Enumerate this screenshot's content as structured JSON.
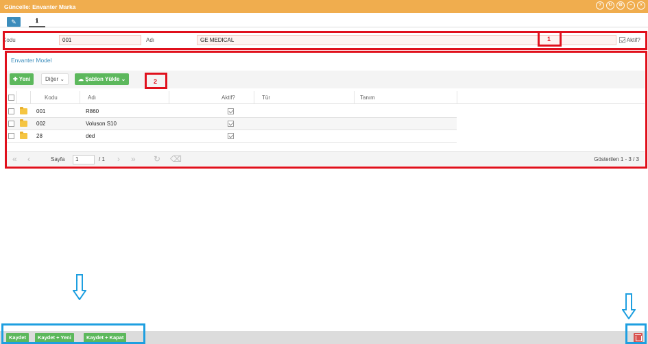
{
  "window": {
    "title": "Güncelle: Envanter Marka",
    "controls": [
      "help-icon",
      "refresh-icon",
      "settings-icon",
      "minimize-icon",
      "close-icon"
    ]
  },
  "tabs": [
    {
      "icon": "edit-icon",
      "active": true
    },
    {
      "icon": "info-icon",
      "active": false
    }
  ],
  "form": {
    "kodu_label": "Kodu",
    "kodu_value": "001",
    "adi_label": "Adı",
    "adi_value": "GE MEDICAL",
    "aktif_label": "Aktif?",
    "aktif_checked": true
  },
  "annotations": {
    "box1_number": "1",
    "box2_number": "2"
  },
  "section": {
    "title": "Envanter Model"
  },
  "toolbar": {
    "new_label": "Yeni",
    "other_label": "Diğer",
    "template_label": "Şablon Yükle"
  },
  "grid": {
    "columns": [
      "Kodu",
      "Adı",
      "Aktif?",
      "Tür",
      "Tanım"
    ],
    "rows": [
      {
        "kodu": "001",
        "adi": "R860",
        "aktif": true,
        "tur": "",
        "tanim": ""
      },
      {
        "kodu": "002",
        "adi": "Voluson S10",
        "aktif": true,
        "tur": "",
        "tanim": ""
      },
      {
        "kodu": "28",
        "adi": "ded",
        "aktif": true,
        "tur": "",
        "tanim": ""
      }
    ]
  },
  "pager": {
    "page_label": "Sayfa",
    "page_value": "1",
    "page_total": "/ 1",
    "summary": "Gösterilen 1 - 3 / 3"
  },
  "footer": {
    "save_label": "Kaydet",
    "save_new_label": "Kaydet + Yeni",
    "save_close_label": "Kaydet + Kapat"
  },
  "colors": {
    "titlebar": "#f0ad4e",
    "accent_blue": "#3c8dbc",
    "button_green": "#5cb85c",
    "delete_red": "#d9534f",
    "annotation_red": "#e0101c",
    "annotation_blue": "#1e9fe0"
  }
}
